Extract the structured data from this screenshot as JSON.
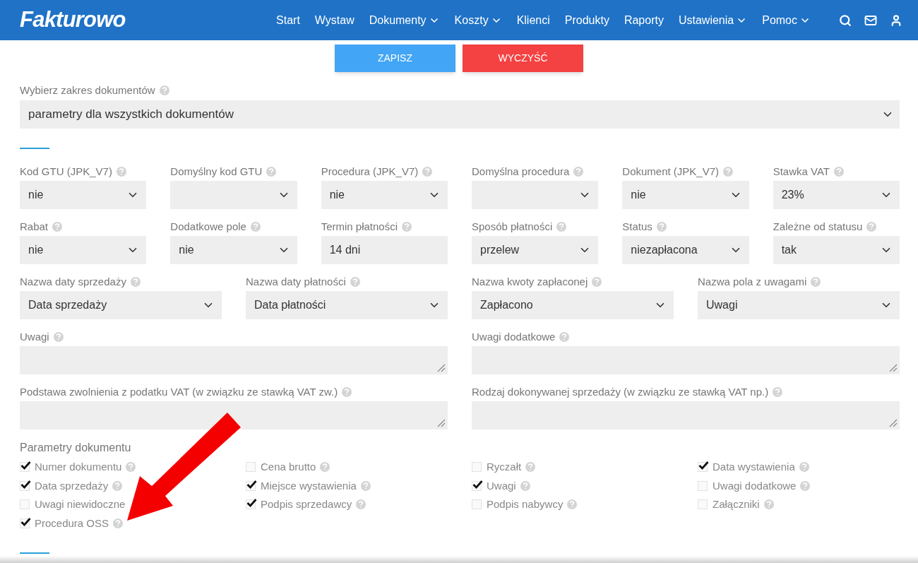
{
  "header": {
    "logo": "Fakturowo",
    "nav": [
      {
        "label": "Start",
        "dropdown": false
      },
      {
        "label": "Wystaw",
        "dropdown": false
      },
      {
        "label": "Dokumenty",
        "dropdown": true
      },
      {
        "label": "Koszty",
        "dropdown": true
      },
      {
        "label": "Klienci",
        "dropdown": false
      },
      {
        "label": "Produkty",
        "dropdown": false
      },
      {
        "label": "Raporty",
        "dropdown": false
      },
      {
        "label": "Ustawienia",
        "dropdown": true
      },
      {
        "label": "Pomoc",
        "dropdown": true
      }
    ]
  },
  "actions": [
    {
      "label": "ZAPISZ",
      "kind": "primary"
    },
    {
      "label": "WYCZYŚĆ",
      "kind": "danger"
    }
  ],
  "scope": {
    "label": "Wybierz zakres dokumentów",
    "help": true,
    "value": "parametry dla wszystkich dokumentów"
  },
  "field_rows": [
    {
      "fields": [
        {
          "label": "Kod GTU (JPK_V7)",
          "help": true,
          "kind": "select",
          "value": "nie"
        },
        {
          "label": "Domyślny kod GTU",
          "help": true,
          "kind": "select"
        },
        {
          "label": "Procedura (JPK_V7)",
          "help": true,
          "kind": "select",
          "value": "nie"
        },
        {
          "label": "Domyślna procedura",
          "help": true,
          "kind": "select"
        },
        {
          "label": "Dokument (JPK_V7)",
          "help": true,
          "kind": "select",
          "value": "nie"
        },
        {
          "label": "Stawka VAT",
          "help": true,
          "kind": "select",
          "value": "23%"
        }
      ]
    },
    {
      "fields": [
        {
          "label": "Rabat",
          "help": true,
          "kind": "select",
          "value": "nie"
        },
        {
          "label": "Dodatkowe pole",
          "help": true,
          "kind": "select",
          "value": "nie"
        },
        {
          "label": "Termin płatności",
          "help": true,
          "kind": "input",
          "value": "14 dni"
        },
        {
          "label": "Sposób płatności",
          "help": true,
          "kind": "select",
          "value": "przelew"
        },
        {
          "label": "Status",
          "help": true,
          "kind": "select",
          "value": "niezapłacona"
        },
        {
          "label": "Zależne od statusu",
          "help": true,
          "kind": "select",
          "value": "tak"
        }
      ]
    },
    {
      "fields": [
        {
          "label": "Nazwa daty sprzedaży",
          "help": true,
          "kind": "select",
          "value": "Data sprzedaży"
        },
        {
          "label": "Nazwa daty płatności",
          "help": true,
          "kind": "select",
          "value": "Data płatności"
        },
        {
          "label": "Nazwa kwoty zapłaconej",
          "help": true,
          "kind": "select",
          "value": "Zapłacono"
        },
        {
          "label": "Nazwa pola z uwagami",
          "help": true,
          "kind": "select",
          "value": "Uwagi"
        }
      ]
    },
    {
      "fields": [
        {
          "label": "Uwagi",
          "help": true,
          "kind": "textarea"
        },
        {
          "label": "Uwagi dodatkowe",
          "help": true,
          "kind": "textarea"
        }
      ]
    },
    {
      "fields": [
        {
          "label": "Podstawa zwolnienia z podatku VAT (w związku ze stawką VAT zw.)",
          "help": true,
          "kind": "textarea"
        },
        {
          "label": "Rodzaj dokonywanej sprzedaży (w związku ze stawką VAT np.)",
          "help": true,
          "kind": "textarea"
        }
      ]
    }
  ],
  "document_params": {
    "title": "Parametry dokumentu",
    "options": [
      {
        "label": "Numer dokumentu",
        "checked": true,
        "help": true
      },
      {
        "label": "Cena brutto",
        "checked": false,
        "help": true
      },
      {
        "label": "Ryczałt",
        "checked": false,
        "help": true
      },
      {
        "label": "Data wystawienia",
        "checked": true,
        "help": true
      },
      {
        "label": "Data sprzedaży",
        "checked": true,
        "help": true
      },
      {
        "label": "Miejsce wystawienia",
        "checked": true,
        "help": true
      },
      {
        "label": "Uwagi",
        "checked": true,
        "help": true
      },
      {
        "label": "Uwagi dodatkowe",
        "checked": false,
        "help": true
      },
      {
        "label": "Uwagi niewidoczne",
        "checked": false,
        "help": false
      },
      {
        "label": "Podpis sprzedawcy",
        "checked": true,
        "help": true
      },
      {
        "label": "Podpis nabywcy",
        "checked": false,
        "help": true
      },
      {
        "label": "Załączniki",
        "checked": false,
        "help": true
      },
      {
        "label": "Procedura OSS",
        "checked": true,
        "help": true
      }
    ]
  }
}
